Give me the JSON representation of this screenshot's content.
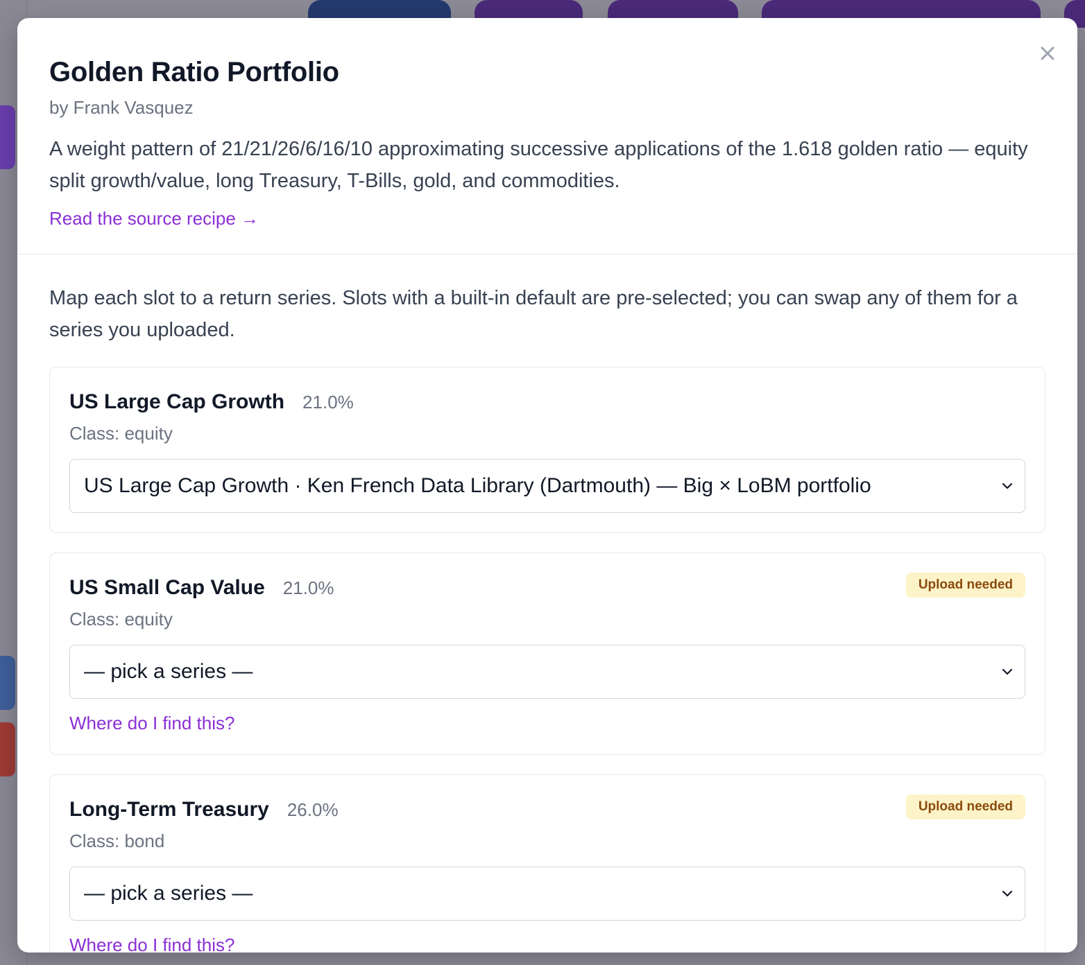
{
  "modal": {
    "title": "Golden Ratio Portfolio",
    "author": "by Frank Vasquez",
    "description": "A weight pattern of 21/21/26/6/16/10 approximating successive applications of the 1.618 golden ratio — equity split growth/value, long Treasury, T-Bills, gold, and commodities.",
    "source_link": "Read the source recipe →",
    "close_icon": "close-icon"
  },
  "body": {
    "intro": "Map each slot to a return series. Slots with a built-in default are pre-selected; you can swap any of them for a series you uploaded."
  },
  "slots": [
    {
      "name": "US Large Cap Growth",
      "weight": "21.0%",
      "class": "Class: equity",
      "selected": "US Large Cap Growth · Ken French Data Library (Dartmouth) — Big × LoBM portfolio",
      "badge": "",
      "help_link": ""
    },
    {
      "name": "US Small Cap Value",
      "weight": "21.0%",
      "class": "Class: equity",
      "selected": "— pick a series —",
      "badge": "Upload needed",
      "help_link": "Where do I find this?"
    },
    {
      "name": "Long-Term Treasury",
      "weight": "26.0%",
      "class": "Class: bond",
      "selected": "— pick a series —",
      "badge": "Upload needed",
      "help_link": "Where do I find this?"
    }
  ],
  "colors": {
    "accent": "#8b2fd6",
    "badge_bg": "#fdf3c8",
    "badge_text": "#8a4b0d"
  }
}
